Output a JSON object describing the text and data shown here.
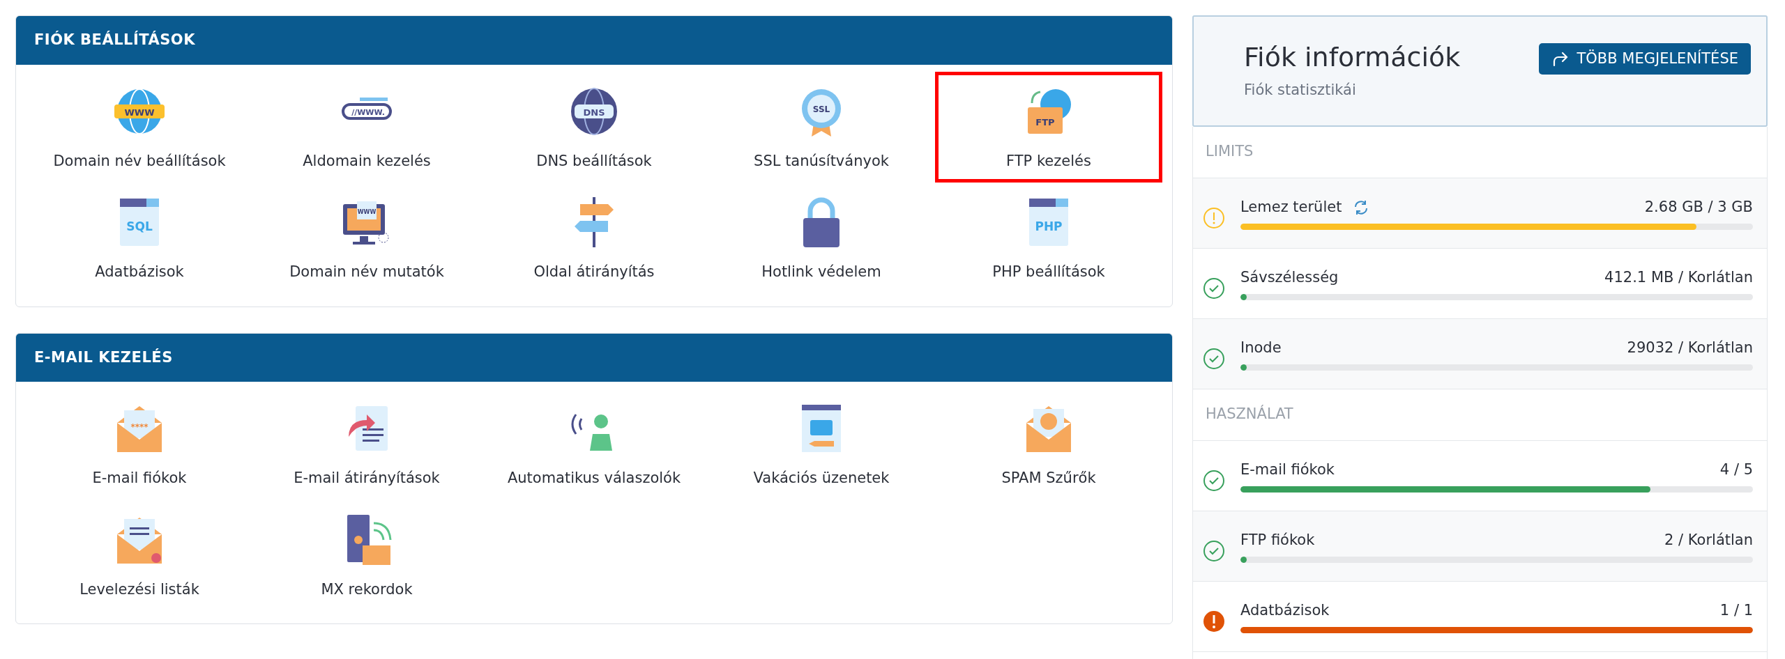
{
  "sections": [
    {
      "title": "FIÓK BEÁLLÍTÁSOK",
      "items": [
        {
          "label": "Domain név beállítások",
          "icon_text": "WWW",
          "highlighted": false
        },
        {
          "label": "Aldomain kezelés",
          "icon_text": "//WWW.",
          "highlighted": false
        },
        {
          "label": "DNS beállítások",
          "icon_text": "DNS",
          "highlighted": false
        },
        {
          "label": "SSL tanúsítványok",
          "icon_text": "SSL",
          "highlighted": false
        },
        {
          "label": "FTP kezelés",
          "icon_text": "FTP",
          "highlighted": true
        },
        {
          "label": "Adatbázisok",
          "icon_text": "SQL",
          "highlighted": false
        },
        {
          "label": "Domain név mutatók",
          "icon_text": "WWW",
          "highlighted": false
        },
        {
          "label": "Oldal átirányítás",
          "highlighted": false
        },
        {
          "label": "Hotlink védelem",
          "highlighted": false
        },
        {
          "label": "PHP beállítások",
          "icon_text": "PHP",
          "highlighted": false
        }
      ]
    },
    {
      "title": "E-MAIL KEZELÉS",
      "items": [
        {
          "label": "E-mail fiókok",
          "icon_text": "****",
          "highlighted": false
        },
        {
          "label": "E-mail átirányítások",
          "highlighted": false
        },
        {
          "label": "Automatikus válaszolók",
          "highlighted": false
        },
        {
          "label": "Vakációs üzenetek",
          "highlighted": false
        },
        {
          "label": "SPAM Szűrők",
          "highlighted": false
        },
        {
          "label": "Levelezési listák",
          "highlighted": false
        },
        {
          "label": "MX rekordok",
          "highlighted": false
        }
      ]
    }
  ],
  "info": {
    "title": "Fiók információk",
    "subtitle": "Fiók statisztikái",
    "button": "TÖBB MEGJELENÍTÉSE"
  },
  "groups": [
    {
      "title": "LIMITS",
      "rows": [
        {
          "label": "Lemez terület",
          "reading": "2.68 GB / 3 GB",
          "kind": "warning",
          "refresh": true,
          "level": 0.89
        },
        {
          "label": "Sávszélesség",
          "reading": "412.1 MB / Korlátlan",
          "kind": "ok",
          "refresh": false,
          "level": 0.006
        },
        {
          "label": "Inode",
          "reading": "29032 / Korlátlan",
          "kind": "ok",
          "refresh": false,
          "level": 0.006
        }
      ]
    },
    {
      "title": "HASZNÁLAT",
      "rows": [
        {
          "label": "E-mail fiókok",
          "reading": "4 / 5",
          "kind": "ok",
          "refresh": false,
          "level": 0.8
        },
        {
          "label": "FTP fiókok",
          "reading": "2 / Korlátlan",
          "kind": "ok",
          "refresh": false,
          "level": 0.006
        },
        {
          "label": "Adatbázisok",
          "reading": "1 / 1",
          "kind": "critical",
          "refresh": false,
          "level": 1
        }
      ]
    }
  ]
}
